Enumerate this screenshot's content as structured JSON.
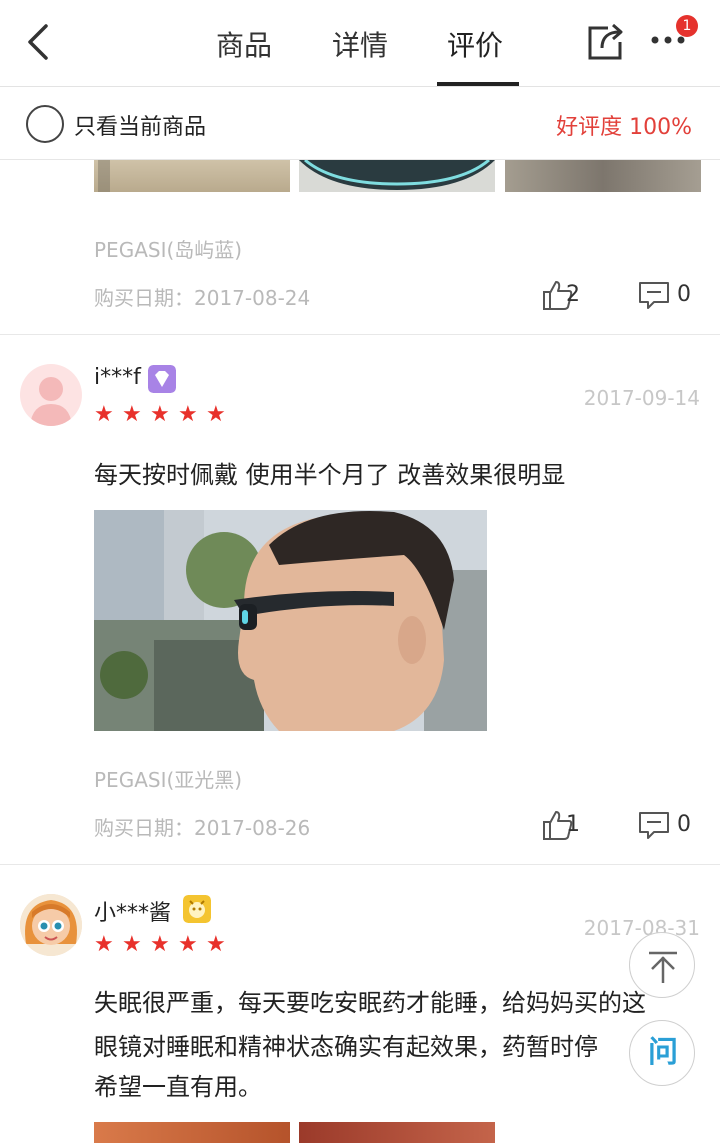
{
  "nav": {
    "tabs": [
      {
        "label": "商品"
      },
      {
        "label": "详情"
      },
      {
        "label": "评价"
      }
    ],
    "active_tab": "评价",
    "notification_count": "1"
  },
  "filter": {
    "only_current_label": "只看当前商品",
    "good_rate": "好评度 100%"
  },
  "reviews": [
    {
      "spec": "PEGASI(岛屿蓝)",
      "purchase_date": "购买日期：2017-08-24",
      "likes": "2",
      "comments": "0"
    },
    {
      "username": "i***f",
      "date": "2017-09-14",
      "rating": 5,
      "text": "每天按时佩戴 使用半个月了 改善效果很明显",
      "spec": "PEGASI(亚光黑)",
      "purchase_date": "购买日期：2017-08-26",
      "likes": "1",
      "comments": "0"
    },
    {
      "username": "小***酱",
      "date": "2017-08-31",
      "rating": 5,
      "text_lines": [
        "失眠很严重，每天要吃安眠药才能睡，给妈妈买的这",
        "眼镜对睡眠和精神状态确实有起效果，药暂时停",
        "希望一直有用。"
      ]
    }
  ],
  "float": {
    "ask_label": "问"
  },
  "colors": {
    "accent_red": "#e2403a",
    "star_red": "#e8312b",
    "muted_text": "#b9b9b9"
  }
}
